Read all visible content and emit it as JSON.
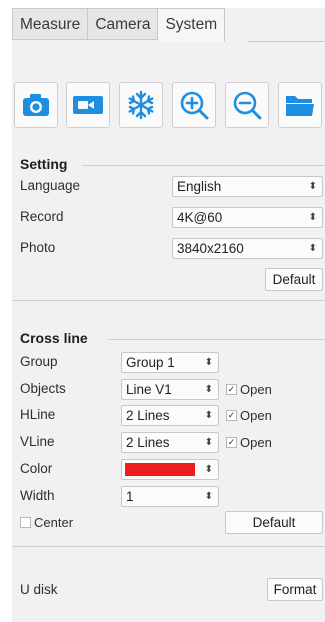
{
  "tabs": [
    {
      "label": "Measure",
      "active": false
    },
    {
      "label": "Camera",
      "active": false
    },
    {
      "label": "System",
      "active": true
    }
  ],
  "toolbar": {
    "icons": [
      "camera-icon",
      "video-record-icon",
      "freeze-snowflake-icon",
      "zoom-in-icon",
      "zoom-out-icon",
      "folder-icon"
    ],
    "accent_color": "#1e8fe0"
  },
  "setting": {
    "title": "Setting",
    "language_label": "Language",
    "language_value": "English",
    "record_label": "Record",
    "record_value": "4K@60",
    "photo_label": "Photo",
    "photo_value": "3840x2160",
    "default_label": "Default"
  },
  "cross_line": {
    "title": "Cross line",
    "group_label": "Group",
    "group_value": "Group 1",
    "objects_label": "Objects",
    "objects_value": "Line V1",
    "objects_open": {
      "label": "Open",
      "checked": true
    },
    "hline_label": "HLine",
    "hline_value": "2 Lines",
    "hline_open": {
      "label": "Open",
      "checked": true
    },
    "vline_label": "VLine",
    "vline_value": "2 Lines",
    "vline_open": {
      "label": "Open",
      "checked": true
    },
    "color_label": "Color",
    "color_value": "#ee1c1c",
    "width_label": "Width",
    "width_value": "1",
    "center": {
      "label": "Center",
      "checked": false
    },
    "default_label": "Default"
  },
  "udisk": {
    "label": "U disk",
    "format_label": "Format"
  },
  "glyphs": {
    "dropdown_arrow": "⬍",
    "check_mark": "✓"
  }
}
